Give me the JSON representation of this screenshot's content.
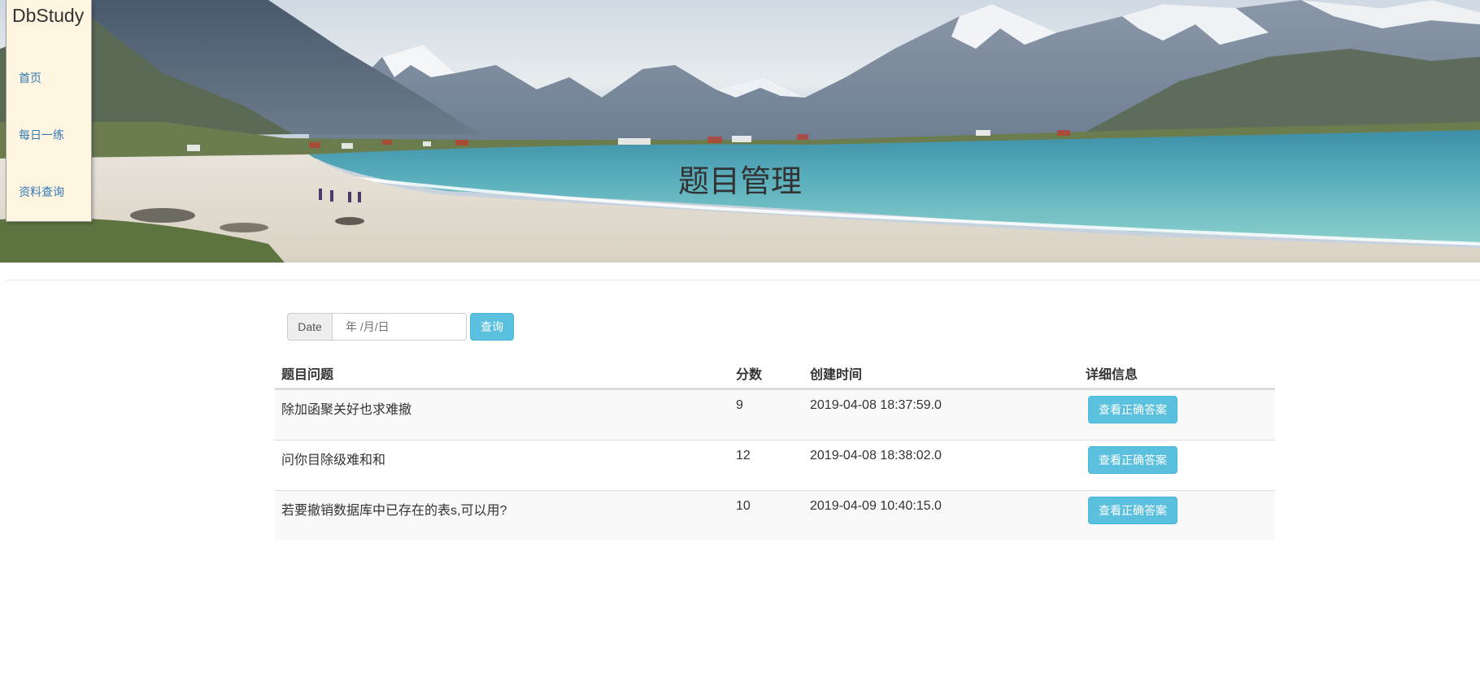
{
  "header": {
    "title": "题目管理"
  },
  "sidebar": {
    "brand": "DbStudy",
    "items": [
      {
        "label": "首页"
      },
      {
        "label": "每日一练"
      },
      {
        "label": "资料查询"
      }
    ]
  },
  "search": {
    "addon_label": "Date",
    "date_placeholder": "年 /月/日",
    "submit_label": "查询"
  },
  "table": {
    "columns": [
      "题目问题",
      "分数",
      "创建时间",
      "详细信息"
    ],
    "rows": [
      {
        "question": "除加函聚关好也求难撤",
        "score": "9",
        "created": "2019-04-08 18:37:59.0",
        "action": "查看正确答案"
      },
      {
        "question": "问你目除级难和和",
        "score": "12",
        "created": "2019-04-08 18:38:02.0",
        "action": "查看正确答案"
      },
      {
        "question": "若要撤销数据库中已存在的表s,可以用?",
        "score": "10",
        "created": "2019-04-09 10:40:15.0",
        "action": "查看正确答案"
      }
    ]
  },
  "colors": {
    "accent": "#5bc0de",
    "link": "#337ab7",
    "sidebar_bg": "#fdf5e0"
  }
}
